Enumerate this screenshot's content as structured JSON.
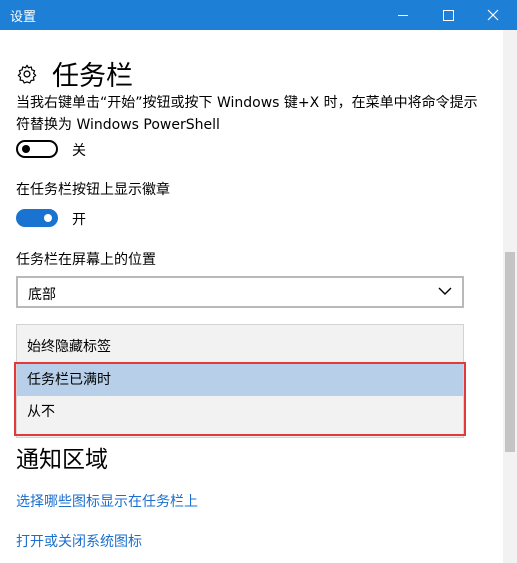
{
  "window": {
    "title": "设置"
  },
  "page": {
    "title": "任务栏"
  },
  "settings": {
    "powershell": {
      "description": "当我右键单击“开始”按钮或按下 Windows 键+X 时，在菜单中将命令提示符替换为 Windows PowerShell",
      "state": "关",
      "on": false
    },
    "badges": {
      "label": "在任务栏按钮上显示徽章",
      "state": "开",
      "on": true
    },
    "position": {
      "label": "任务栏在屏幕上的位置",
      "value": "底部"
    }
  },
  "combine_menu": {
    "options": [
      "始终隐藏标签",
      "任务栏已满时",
      "从不"
    ],
    "selected_index": 1
  },
  "notification_area": {
    "title": "通知区域",
    "links": [
      "选择哪些图标显示在任务栏上",
      "打开或关闭系统图标"
    ]
  },
  "colors": {
    "accent": "#1a73d1",
    "titlebar": "#1e7fd6",
    "highlight": "#e23a3a"
  }
}
